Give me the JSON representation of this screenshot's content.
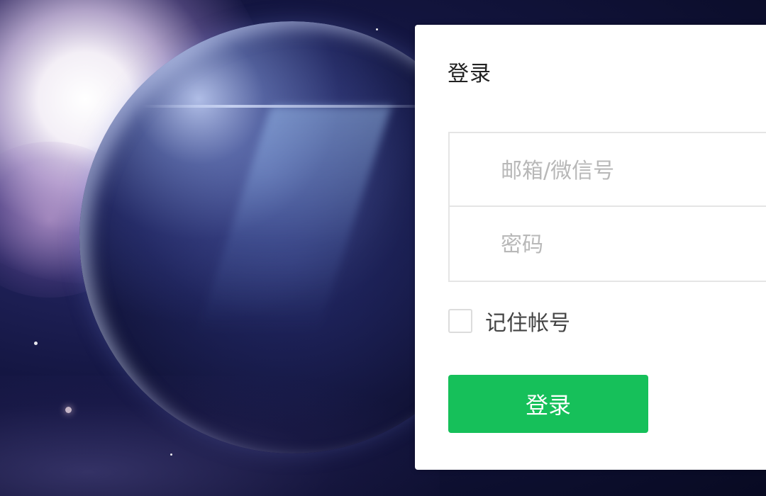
{
  "login": {
    "title": "登录",
    "account_placeholder": "邮箱/微信号",
    "password_placeholder": "密码",
    "remember_label": "记住帐号",
    "remember_checked": false,
    "submit_label": "登录"
  },
  "colors": {
    "button_green": "#16c05a",
    "panel_background": "#ffffff",
    "border": "#e5e5e5"
  }
}
